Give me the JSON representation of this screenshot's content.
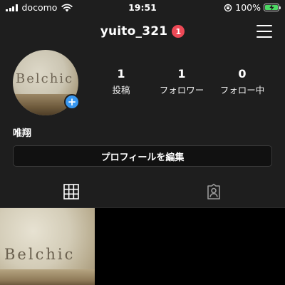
{
  "status_bar": {
    "carrier": "docomo",
    "time": "19:51",
    "battery_percent": "100%",
    "battery_level": 1.0
  },
  "header": {
    "username": "yuito_321",
    "notification_count": "1",
    "menu_icon": "hamburger-menu-icon"
  },
  "profile": {
    "avatar_text": "Belchic",
    "add_story_symbol": "+",
    "stats": [
      {
        "value": "1",
        "label": "投稿"
      },
      {
        "value": "1",
        "label": "フォロワー"
      },
      {
        "value": "0",
        "label": "フォロー中"
      }
    ],
    "display_name": "唯翔",
    "edit_profile_label": "プロフィールを編集"
  },
  "tabs": [
    {
      "icon": "grid-icon",
      "active": true
    },
    {
      "icon": "tagged-person-icon",
      "active": false
    }
  ],
  "posts": [
    {
      "text": "Belchic"
    }
  ],
  "colors": {
    "background": "#1e1e1e",
    "badge_red": "#ed4956",
    "add_blue": "#3897f0",
    "battery_green": "#4cd964"
  }
}
